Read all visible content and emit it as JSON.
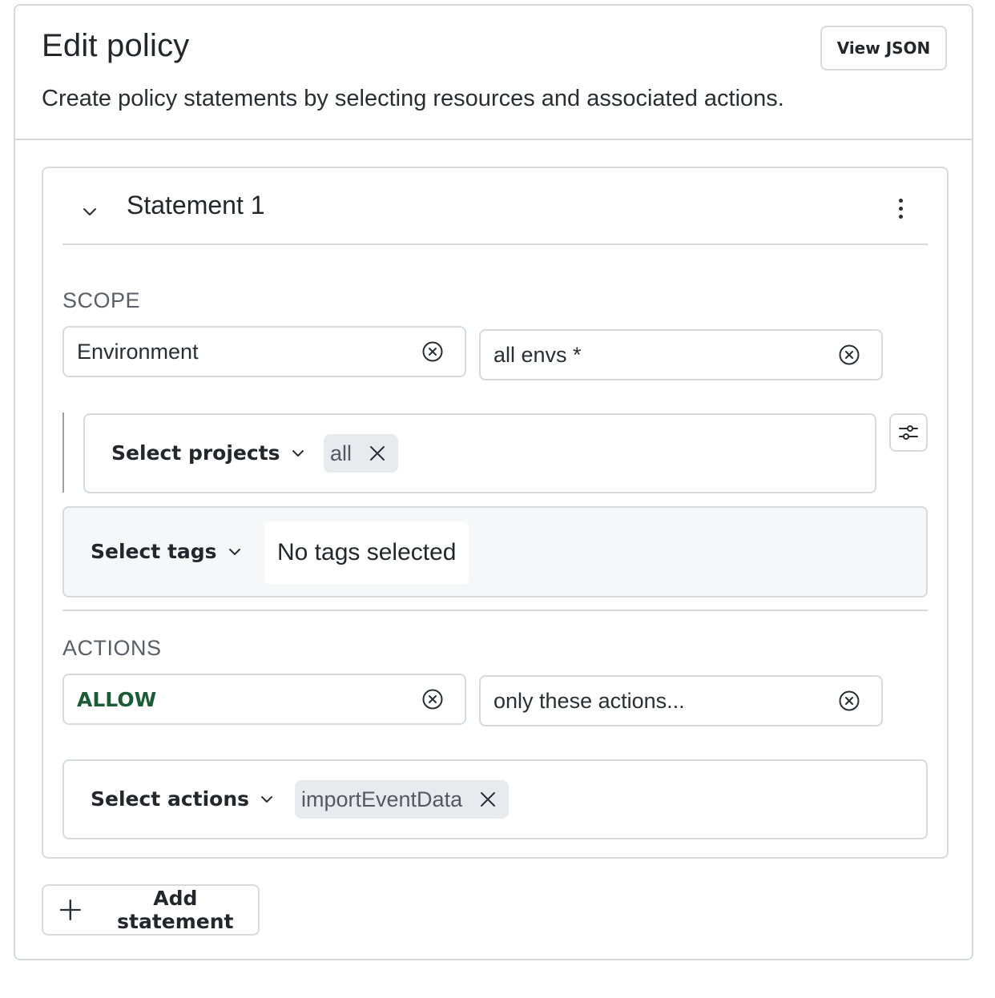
{
  "header": {
    "title": "Edit policy",
    "view_json_label": "View JSON",
    "subtitle": "Create policy statements by selecting resources and associated actions."
  },
  "statement": {
    "title": "Statement 1",
    "scope": {
      "section_label": "SCOPE",
      "resource_type": "Environment",
      "resource_value": "all envs *",
      "projects": {
        "trigger_label": "Select projects",
        "selected": [
          "all"
        ]
      },
      "tags": {
        "trigger_label": "Select tags",
        "empty_text": "No tags selected"
      }
    },
    "actions": {
      "section_label": "ACTIONS",
      "effect": "ALLOW",
      "mode": "only these actions...",
      "trigger_label": "Select actions",
      "selected": [
        "importEventData"
      ]
    }
  },
  "add_statement_label": "Add statement",
  "colors": {
    "allow_green": "#1a5c35",
    "border": "#d6d9de",
    "chip_bg": "#e8ebee",
    "tags_bg": "#f6f7f9"
  },
  "icons": {
    "toggle": "chevron-down-icon",
    "menu": "kebab-menu-icon",
    "clear": "clear-circle-icon",
    "remove": "close-icon",
    "filter": "sliders-icon",
    "add": "plus-icon"
  }
}
